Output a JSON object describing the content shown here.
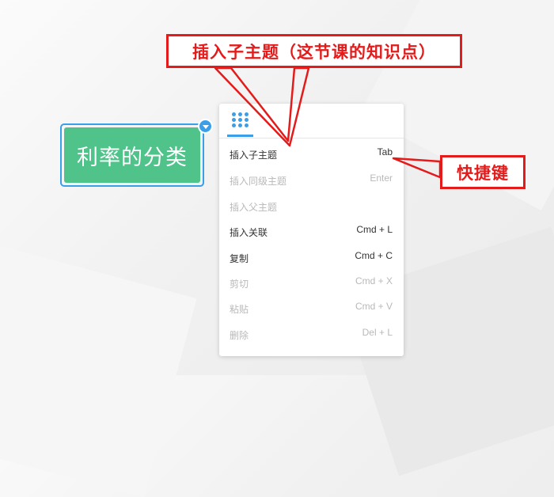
{
  "topic": {
    "label": "利率的分类"
  },
  "menu": {
    "items": [
      {
        "label": "插入子主题",
        "shortcut": "Tab",
        "enabled": true
      },
      {
        "label": "插入同级主题",
        "shortcut": "Enter",
        "enabled": false
      },
      {
        "label": "插入父主题",
        "shortcut": "",
        "enabled": false
      },
      {
        "label": "插入关联",
        "shortcut": "Cmd + L",
        "enabled": true
      },
      {
        "label": "复制",
        "shortcut": "Cmd + C",
        "enabled": true
      },
      {
        "label": "剪切",
        "shortcut": "Cmd + X",
        "enabled": false
      },
      {
        "label": "粘贴",
        "shortcut": "Cmd + V",
        "enabled": false
      },
      {
        "label": "删除",
        "shortcut": "Del + L",
        "enabled": false
      }
    ]
  },
  "annotations": {
    "insert_subtopic_note": "插入子主题（这节课的知识点）",
    "shortcut_note": "快捷键"
  },
  "colors": {
    "accent": "#3a9ee8",
    "topic_fill": "#4fc38a",
    "annotation_red": "#e31b1b"
  }
}
